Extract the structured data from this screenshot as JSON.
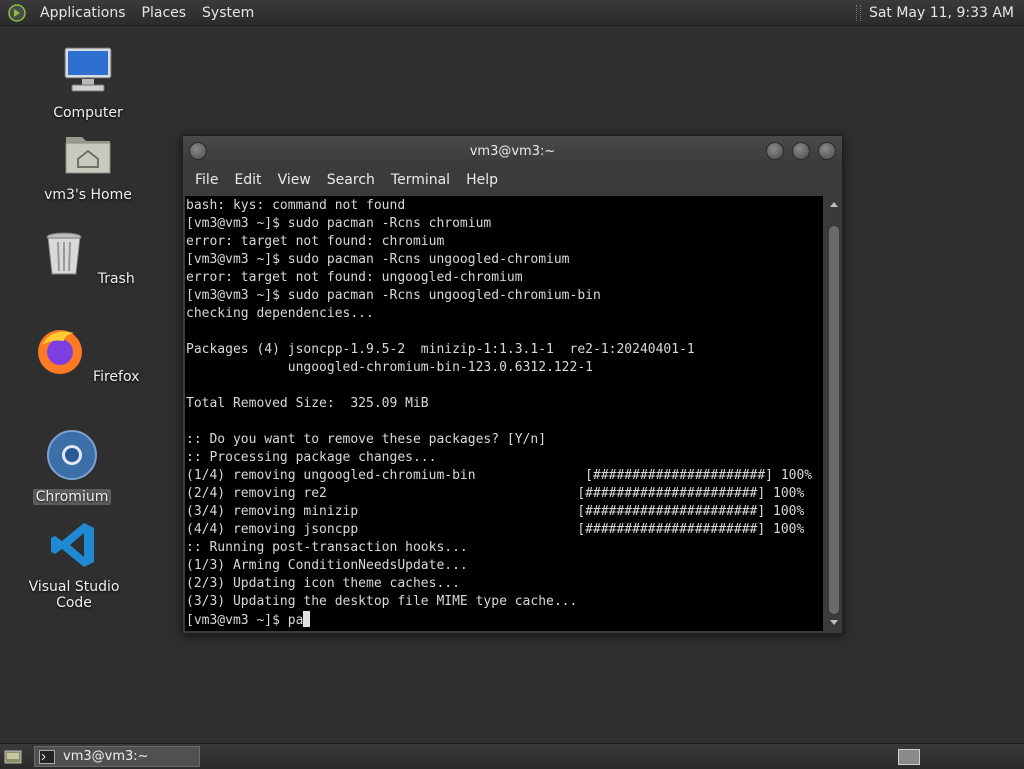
{
  "top_panel": {
    "menus": [
      "Applications",
      "Places",
      "System"
    ],
    "clock": "Sat May 11,  9:33 AM"
  },
  "desktop": {
    "icons": [
      {
        "label": "Computer",
        "icon": "computer-icon"
      },
      {
        "label": "vm3's Home",
        "icon": "home-folder-icon"
      },
      {
        "label": "Trash",
        "icon": "trash-icon"
      },
      {
        "label": "Firefox",
        "icon": "firefox-icon"
      },
      {
        "label": "Chromium",
        "icon": "chromium-icon",
        "selected": true
      },
      {
        "label": "Visual Studio Code",
        "icon": "vscode-icon"
      }
    ]
  },
  "terminal": {
    "title": "vm3@vm3:~",
    "menu": [
      "File",
      "Edit",
      "View",
      "Search",
      "Terminal",
      "Help"
    ],
    "lines": [
      "bash: kys: command not found",
      "[vm3@vm3 ~]$ sudo pacman -Rcns chromium",
      "error: target not found: chromium",
      "[vm3@vm3 ~]$ sudo pacman -Rcns ungoogled-chromium",
      "error: target not found: ungoogled-chromium",
      "[vm3@vm3 ~]$ sudo pacman -Rcns ungoogled-chromium-bin",
      "checking dependencies...",
      "",
      "Packages (4) jsoncpp-1.9.5-2  minizip-1:1.3.1-1  re2-1:20240401-1",
      "             ungoogled-chromium-bin-123.0.6312.122-1",
      "",
      "Total Removed Size:  325.09 MiB",
      "",
      ":: Do you want to remove these packages? [Y/n]",
      ":: Processing package changes...",
      "(1/4) removing ungoogled-chromium-bin              [######################] 100%",
      "(2/4) removing re2                                [######################] 100%",
      "(3/4) removing minizip                            [######################] 100%",
      "(4/4) removing jsoncpp                            [######################] 100%",
      ":: Running post-transaction hooks...",
      "(1/3) Arming ConditionNeedsUpdate...",
      "(2/3) Updating icon theme caches...",
      "(3/3) Updating the desktop file MIME type cache..."
    ],
    "prompt": "[vm3@vm3 ~]$ ",
    "input": "pa"
  },
  "taskbar": {
    "task_label": "vm3@vm3:~"
  }
}
